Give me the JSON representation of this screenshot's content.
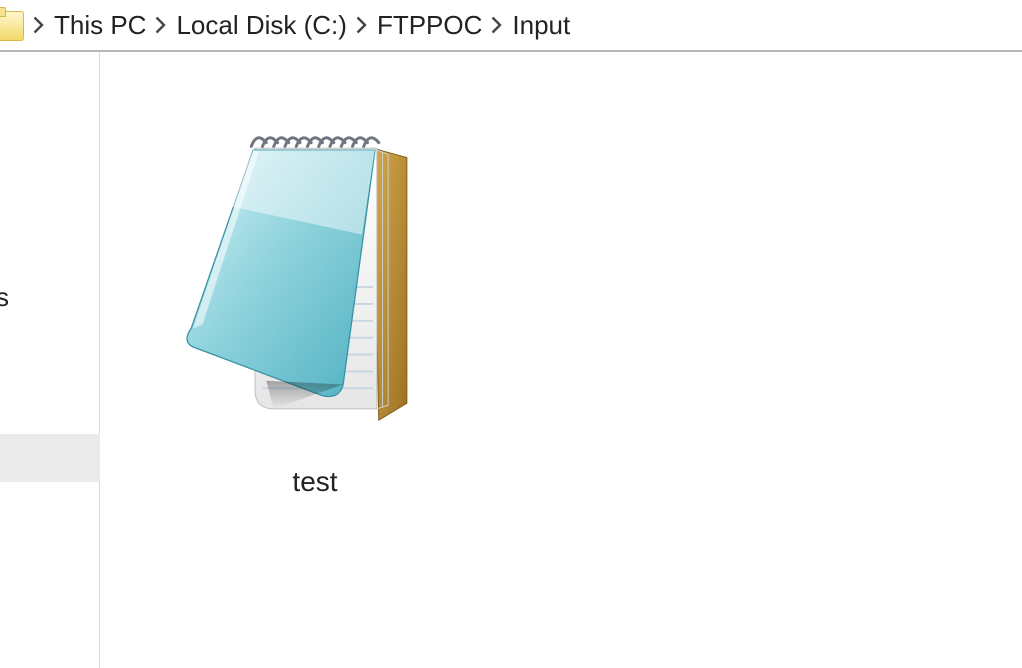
{
  "breadcrumb": {
    "items": [
      {
        "label": "This PC"
      },
      {
        "label": "Local Disk (C:)"
      },
      {
        "label": "FTPPOC"
      },
      {
        "label": "Input"
      }
    ]
  },
  "nav": {
    "truncated_label": "s"
  },
  "files": [
    {
      "name": "test",
      "icon": "notepad-icon"
    }
  ]
}
